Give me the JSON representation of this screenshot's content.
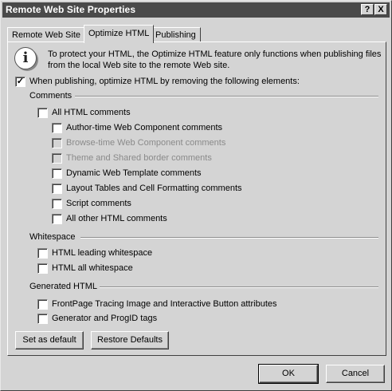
{
  "window": {
    "title": "Remote Web Site Properties"
  },
  "titlebar": {
    "help_label": "?",
    "close_label": "X"
  },
  "tabs": [
    {
      "label": "Remote Web Site",
      "active": false
    },
    {
      "label": "Optimize HTML",
      "active": true
    },
    {
      "label": "Publishing",
      "active": false
    }
  ],
  "info": {
    "icon": "info-icon",
    "glyph": "i",
    "text": "To protect your HTML, the Optimize HTML feature only functions when publishing files from the local Web site to the remote Web site."
  },
  "master": {
    "label": "When publishing, optimize HTML by removing the following elements:",
    "checked": true
  },
  "comments": {
    "heading": "Comments",
    "all": {
      "label": "All HTML comments",
      "checked": false
    },
    "items": [
      {
        "label": "Author-time Web Component comments",
        "checked": false,
        "enabled": true
      },
      {
        "label": "Browse-time Web Component comments",
        "checked": false,
        "enabled": false
      },
      {
        "label": "Theme and Shared border comments",
        "checked": false,
        "enabled": false
      },
      {
        "label": "Dynamic Web Template comments",
        "checked": false,
        "enabled": true
      },
      {
        "label": "Layout Tables and Cell Formatting comments",
        "checked": false,
        "enabled": true
      },
      {
        "label": "Script comments",
        "checked": false,
        "enabled": true
      },
      {
        "label": "All other HTML comments",
        "checked": false,
        "enabled": true
      }
    ]
  },
  "whitespace": {
    "heading": "Whitespace",
    "items": [
      {
        "label": "HTML leading whitespace",
        "checked": false
      },
      {
        "label": "HTML all whitespace",
        "checked": false
      }
    ]
  },
  "generated": {
    "heading": "Generated HTML",
    "items": [
      {
        "label": "FrontPage Tracing Image and Interactive Button attributes",
        "checked": false
      },
      {
        "label": "Generator and ProgID tags",
        "checked": false
      }
    ]
  },
  "panel_buttons": {
    "set_default": "Set as default",
    "restore_defaults": "Restore Defaults"
  },
  "dialog_buttons": {
    "ok": "OK",
    "cancel": "Cancel"
  }
}
